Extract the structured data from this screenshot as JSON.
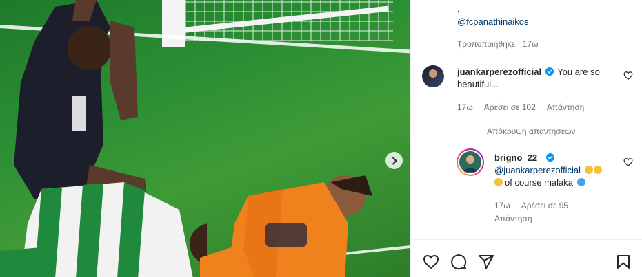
{
  "caption": {
    "dot": ".",
    "mention": "@fcpanathinaikos",
    "edited": "Τροποποιήθηκε · 17ω"
  },
  "comment1": {
    "username": "juankarperezofficial",
    "text_line1": "You are so",
    "text_line2": "beautiful...",
    "time": "17ω",
    "likes": "Αρέσει σε 102",
    "reply": "Απάντηση"
  },
  "hide_replies": "Απόκρυψη απαντήσεων",
  "reply1": {
    "username": "brigno_22_",
    "mention": "@juankarperezofficial",
    "text_line2": "of course malaka",
    "time": "17ω",
    "likes": "Αρέσει σε 95",
    "reply": "Απάντηση"
  },
  "icons": {
    "like": "heart-icon",
    "comment": "comment-icon",
    "share": "share-icon",
    "save": "bookmark-icon",
    "next": "chevron-right-icon",
    "verified": "verified-badge-icon"
  },
  "colors": {
    "verified": "#0095f6",
    "link": "#00376b",
    "muted": "#737373"
  }
}
